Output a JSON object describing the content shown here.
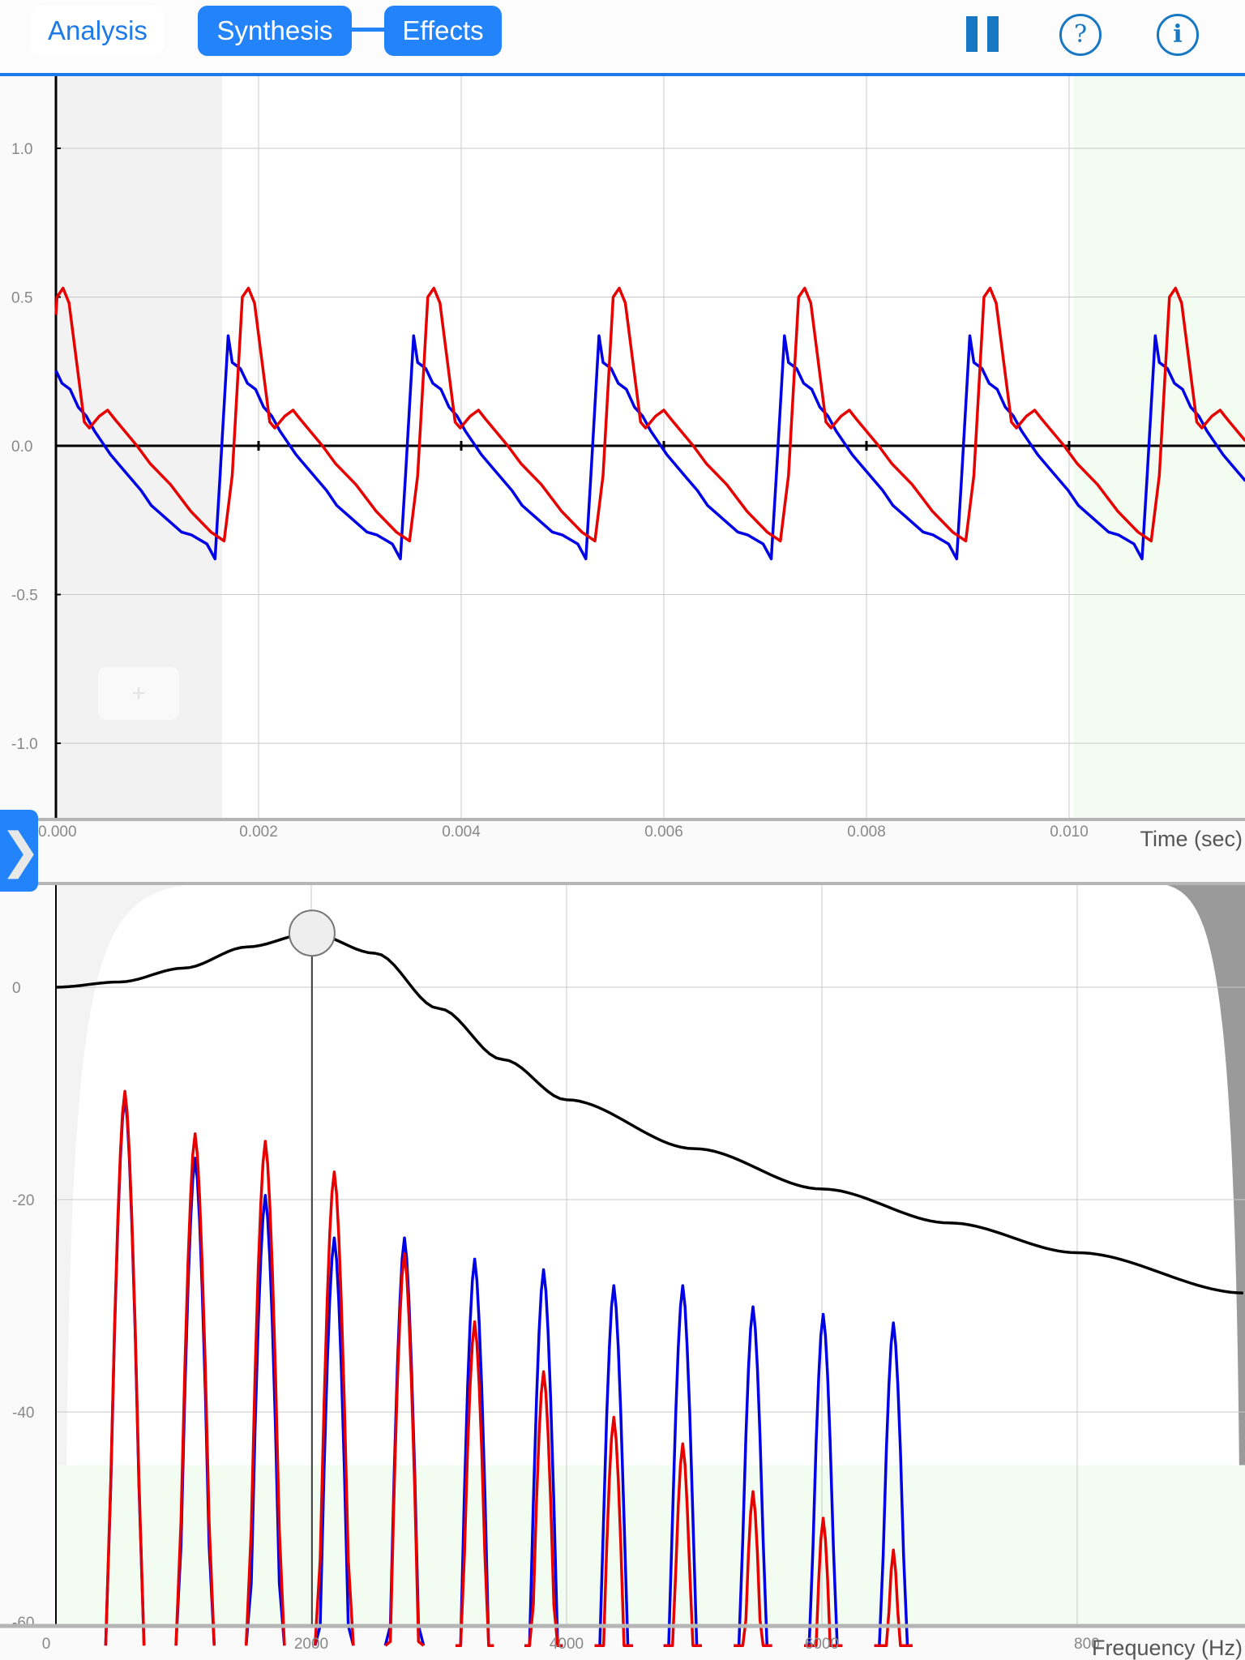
{
  "topbar": {
    "tabs": [
      {
        "label": "Analysis",
        "active": false
      },
      {
        "label": "Synthesis",
        "active": true
      },
      {
        "label": "Effects",
        "active": true
      }
    ],
    "pause_icon": "pause-icon",
    "help_label": "?",
    "info_label": "i",
    "accent": "#2283fb"
  },
  "expand_label": "❯",
  "add_label": "+",
  "chart_data": [
    {
      "type": "line",
      "xlabel": "Time (sec)",
      "xlim": [
        0,
        0.01174
      ],
      "ylim": [
        -1.25,
        1.25
      ],
      "xticks": [
        "0.000",
        "0.002",
        "0.004",
        "0.006",
        "0.008",
        "0.010"
      ],
      "xtick_values": [
        0,
        0.002,
        0.004,
        0.006,
        0.008,
        0.01
      ],
      "yticks": [
        "1.0",
        "0.5",
        "0.0",
        "-0.5",
        "-1.0"
      ],
      "ytick_values": [
        1.0,
        0.5,
        0.0,
        -0.5,
        -1.0
      ],
      "grid": true,
      "period": 0.00183,
      "series": [
        {
          "color": "#0000e6",
          "t": [
            0.00157,
            0.00162,
            0.0017,
            0.00174,
            0.00182,
            0.00189,
            0.00197,
            0.00205,
            0.00213,
            0.00221,
            0.00229,
            0.00237,
            0.00247,
            0.00257,
            0.00267,
            0.00277,
            0.00287,
            0.00297,
            0.00307,
            0.00317,
            0.00332,
            0.0034
          ],
          "values": [
            -0.38,
            -0.1,
            0.37,
            0.28,
            0.26,
            0.21,
            0.19,
            0.13,
            0.1,
            0.05,
            0.01,
            -0.03,
            -0.07,
            -0.11,
            -0.15,
            -0.2,
            -0.23,
            -0.26,
            -0.29,
            -0.3,
            -0.33,
            -0.38
          ]
        },
        {
          "color": "#e60000",
          "t": [
            0.00166,
            0.00174,
            0.00184,
            0.0019,
            0.00196,
            0.00211,
            0.00216,
            0.00226,
            0.00234,
            0.00241,
            0.00263,
            0.00276,
            0.00296,
            0.00316,
            0.00336,
            0.00349
          ],
          "values": [
            -0.32,
            -0.1,
            0.5,
            0.53,
            0.48,
            0.08,
            0.06,
            0.1,
            0.12,
            0.09,
            0.0,
            -0.06,
            -0.13,
            -0.22,
            -0.29,
            -0.32
          ]
        }
      ],
      "shaded_regions": {
        "left_gray_until": 0.00164,
        "right_green_from": 0.01005
      }
    },
    {
      "type": "line",
      "xlabel": "Frequency (Hz)",
      "xlim": [
        0,
        9314
      ],
      "ylim": [
        -60,
        8
      ],
      "xticks": [
        "0",
        "2000",
        "4000",
        "6000",
        "800"
      ],
      "xtick_values": [
        0,
        2000,
        4000,
        6000,
        8000
      ],
      "yticks": [
        "0",
        "-20",
        "-40",
        "-60"
      ],
      "ytick_values": [
        0,
        -20,
        -40,
        -60
      ],
      "grid": true,
      "filter_curve": {
        "color": "#000000",
        "freq": [
          0,
          500,
          1000,
          1500,
          2000,
          2500,
          3000,
          3500,
          4000,
          5000,
          6000,
          7000,
          8000,
          9314
        ],
        "db": [
          0,
          0.5,
          1.8,
          3.8,
          5.1,
          3.2,
          -2.0,
          -6.8,
          -10.6,
          -15.2,
          -19.0,
          -22.2,
          -25.0,
          -28.8
        ]
      },
      "filter_knob": {
        "freq": 2006,
        "db": 5.1
      },
      "harmonics_hz": [
        540,
        1090,
        1640,
        2180,
        2730,
        3280,
        3820,
        4370,
        4910,
        5460,
        6010,
        6560
      ],
      "series": [
        {
          "color": "#0000e6",
          "peak_db": [
            -10.3,
            -16.1,
            -19.6,
            -23.6,
            -23.6,
            -25.6,
            -26.6,
            -28.1,
            -28.1,
            -30.1,
            -30.8,
            -31.6
          ]
        },
        {
          "color": "#e60000",
          "peak_db": [
            -9.8,
            -13.8,
            -14.5,
            -17.4,
            -25.1,
            -31.5,
            -36.2,
            -40.5,
            -43.0,
            -47.5,
            -50.0,
            -53.0
          ]
        }
      ],
      "noise_floor_db": -45
    }
  ]
}
